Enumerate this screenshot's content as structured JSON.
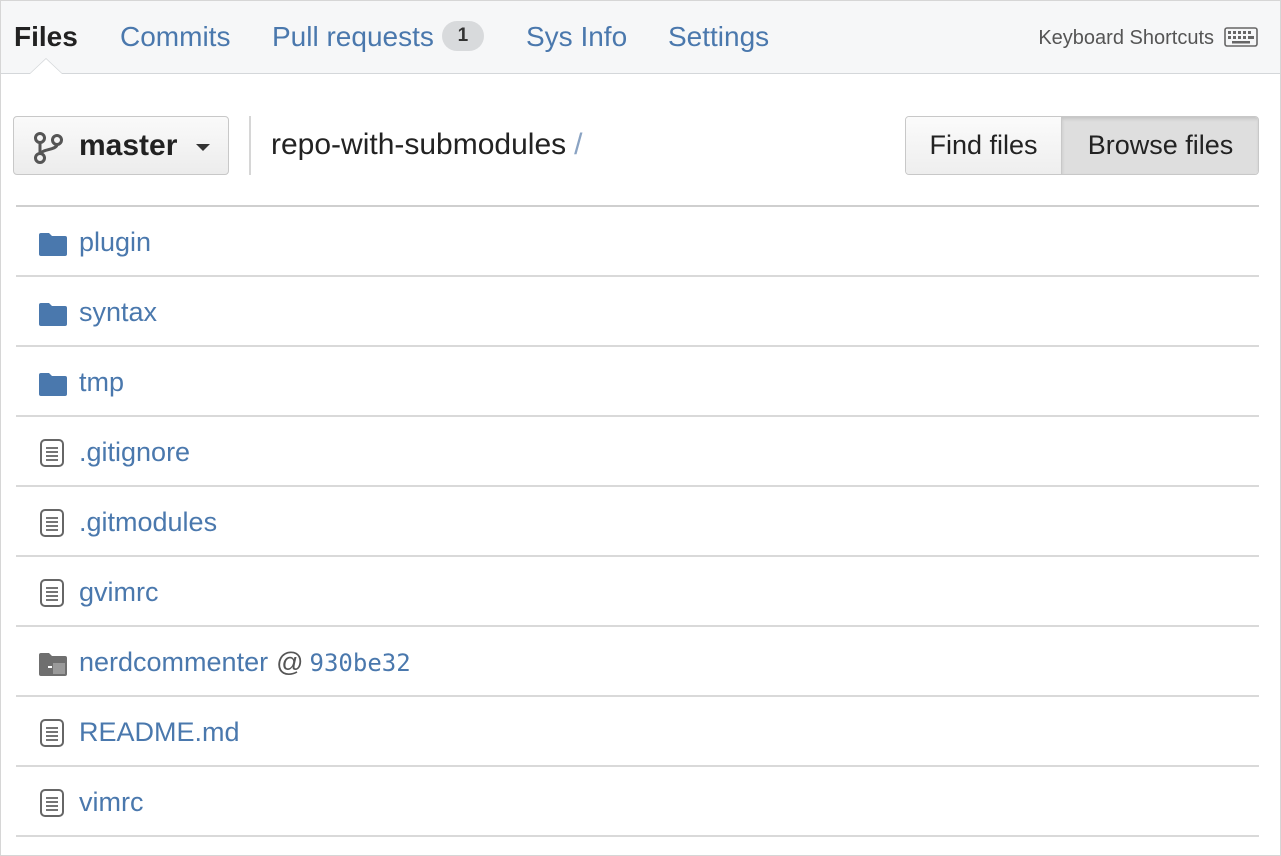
{
  "nav": {
    "tabs": [
      {
        "label": "Files"
      },
      {
        "label": "Commits"
      },
      {
        "label": "Pull requests",
        "badge": "1"
      },
      {
        "label": "Sys Info"
      },
      {
        "label": "Settings"
      }
    ],
    "shortcuts_label": "Keyboard Shortcuts",
    "shortcuts_icon": "keyboard-icon"
  },
  "toolbar": {
    "branch": "master",
    "branch_icon": "git-branch-icon",
    "repo_name": "repo-with-submodules",
    "path_separator": "/",
    "find_files_label": "Find files",
    "browse_files_label": "Browse files"
  },
  "files": [
    {
      "name": "plugin",
      "type": "folder",
      "icon": "folder-icon"
    },
    {
      "name": "syntax",
      "type": "folder",
      "icon": "folder-icon"
    },
    {
      "name": "tmp",
      "type": "folder",
      "icon": "folder-icon"
    },
    {
      "name": ".gitignore",
      "type": "file",
      "icon": "file-text-icon"
    },
    {
      "name": ".gitmodules",
      "type": "file",
      "icon": "file-text-icon"
    },
    {
      "name": "gvimrc",
      "type": "file",
      "icon": "file-text-icon"
    },
    {
      "name": "nerdcommenter",
      "type": "submodule",
      "icon": "submodule-icon",
      "at": "@",
      "commit": "930be32"
    },
    {
      "name": "README.md",
      "type": "file",
      "icon": "file-text-icon"
    },
    {
      "name": "vimrc",
      "type": "file",
      "icon": "file-text-icon"
    }
  ],
  "colors": {
    "link": "#4a78ad",
    "folder": "#4a78ad",
    "submodule": "#777777",
    "nav_bg": "#f6f7f8"
  }
}
